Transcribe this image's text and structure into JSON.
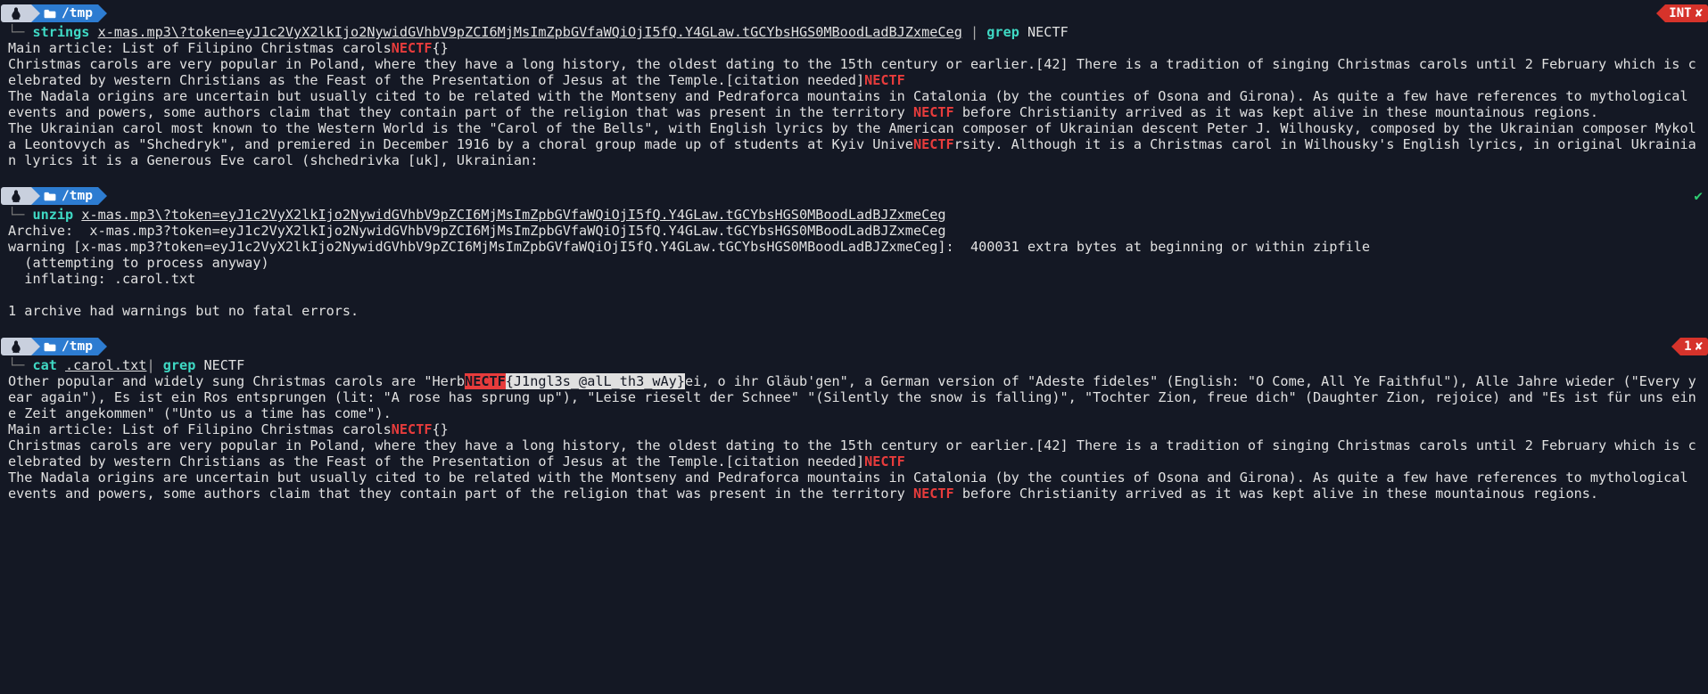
{
  "prompts": {
    "path": "/tmp",
    "badge_int": "INT",
    "badge_one": "1"
  },
  "block1": {
    "cmd": "strings",
    "arg": "x-mas.mp3\\?token=eyJ1c2VyX2lkIjo2NywidGVhbV9pZCI6MjMsImZpbGVfaWQiOjI5fQ.Y4GLaw.tGCYbsHGS0MBoodLadBJZxmeCeg",
    "pipe": " | ",
    "grep": "grep",
    "grep_arg": "NECTF",
    "out": {
      "l1a": "Main article: List of Filipino Christmas carols",
      "l1hl": "NECTF",
      "l1b": "{}",
      "l2a": "Christmas carols are very popular in Poland, where they have a long history, the oldest dating to the 15th century or earlier.[42] There is a tradition of singing Christmas carols until 2 February which is celebrated by western Christians as the Feast of the Presentation of Jesus at the Temple.[citation needed]",
      "l2hl": "NECTF",
      "l3a": "The Nadala origins are uncertain but usually cited to be related with the Montseny and Pedraforca mountains in Catalonia (by the counties of Osona and Girona). As quite a few have references to mythological events and powers, some authors claim that they contain part of the religion that was present in the territory ",
      "l3hl": "NECTF",
      "l3b": " before Christianity arrived as it was kept alive in these mountainous regions.",
      "l4a": "The Ukrainian carol most known to the Western World is the \"Carol of the Bells\", with English lyrics by the American composer of Ukrainian descent Peter J. Wilhousky, composed by the Ukrainian composer Mykola Leontovych as \"Shchedryk\", and premiered in December 1916 by a choral group made up of students at Kyiv Unive",
      "l4hl": "NECTF",
      "l4b": "rsity. Although it is a Christmas carol in Wilhousky's English lyrics, in original Ukrainian lyrics it is a Generous Eve carol (shchedrivka [uk], Ukrainian:"
    }
  },
  "block2": {
    "cmd": "unzip",
    "arg": "x-mas.mp3\\?token=eyJ1c2VyX2lkIjo2NywidGVhbV9pZCI6MjMsImZpbGVfaWQiOjI5fQ.Y4GLaw.tGCYbsHGS0MBoodLadBJZxmeCeg",
    "out": {
      "l1": "Archive:  x-mas.mp3?token=eyJ1c2VyX2lkIjo2NywidGVhbV9pZCI6MjMsImZpbGVfaWQiOjI5fQ.Y4GLaw.tGCYbsHGS0MBoodLadBJZxmeCeg",
      "l2": "warning [x-mas.mp3?token=eyJ1c2VyX2lkIjo2NywidGVhbV9pZCI6MjMsImZpbGVfaWQiOjI5fQ.Y4GLaw.tGCYbsHGS0MBoodLadBJZxmeCeg]:  400031 extra bytes at beginning or within zipfile",
      "l3": "  (attempting to process anyway)",
      "l4": "  inflating: .carol.txt",
      "l5": "1 archive had warnings but no fatal errors."
    }
  },
  "block3": {
    "cmd": "cat",
    "arg": ".carol.txt",
    "pipe": "| ",
    "grep": "grep",
    "grep_arg": "NECTF",
    "out": {
      "l1a": "Other popular and widely sung Christmas carols are \"Herb",
      "l1hl": "NECTF",
      "l1sel": "{J1ngl3s_@alL_th3_wAy}",
      "l1b": "ei, o ihr Gläub'gen\", a German version of \"Adeste fideles\" (English: \"O Come, All Ye Faithful\"), Alle Jahre wieder (\"Every year again\"), Es ist ein Ros entsprungen (lit: \"A rose has sprung up\"), \"Leise rieselt der Schnee\" \"(Silently the snow is falling)\", \"Tochter Zion, freue dich\" (Daughter Zion, rejoice) and \"Es ist für uns eine Zeit angekommen\" (\"Unto us a time has come\").",
      "l2a": "Main article: List of Filipino Christmas carols",
      "l2hl": "NECTF",
      "l2b": "{}",
      "l3a": "Christmas carols are very popular in Poland, where they have a long history, the oldest dating to the 15th century or earlier.[42] There is a tradition of singing Christmas carols until 2 February which is celebrated by western Christians as the Feast of the Presentation of Jesus at the Temple.[citation needed]",
      "l3hl": "NECTF",
      "l4a": "The Nadala origins are uncertain but usually cited to be related with the Montseny and Pedraforca mountains in Catalonia (by the counties of Osona and Girona). As quite a few have references to mythological events and powers, some authors claim that they contain part of the religion that was present in the territory ",
      "l4hl": "NECTF",
      "l4b": " before Christianity arrived as it was kept alive in these mountainous regions."
    }
  }
}
